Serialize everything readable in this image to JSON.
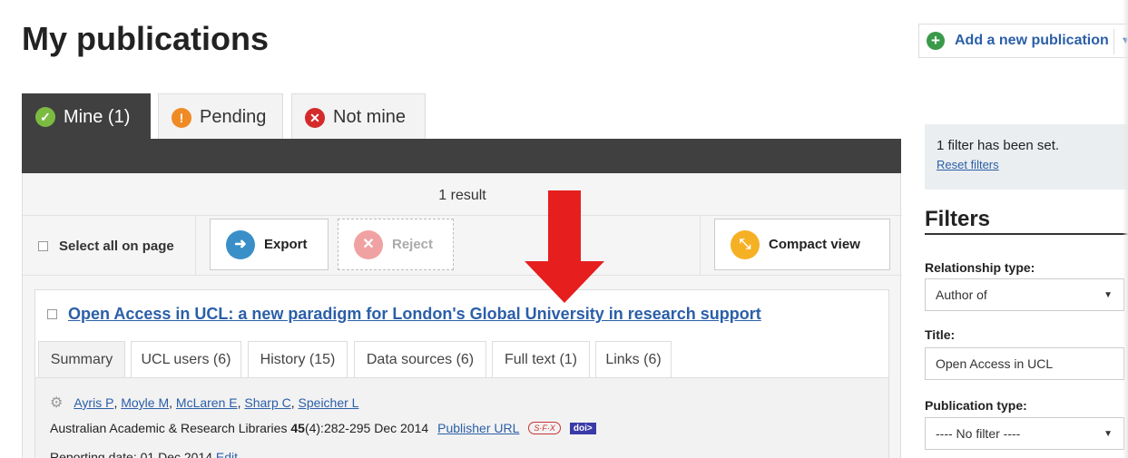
{
  "header": {
    "title": "My publications",
    "add_publication_label": "Add a new publication"
  },
  "tabs": [
    {
      "label": "Mine (1)",
      "icon": "check-circle-icon"
    },
    {
      "label": "Pending",
      "icon": "exclamation-circle-icon"
    },
    {
      "label": "Not mine",
      "icon": "x-circle-icon"
    }
  ],
  "results": {
    "count_text": "1 result",
    "select_all_label": "Select all on page",
    "export_label": "Export",
    "reject_label": "Reject",
    "compact_view_label": "Compact view"
  },
  "publication": {
    "title": "Open Access in UCL: a new paradigm for London's Global University in research support",
    "sub_tabs": [
      {
        "label": "Summary"
      },
      {
        "label": "UCL users (6)"
      },
      {
        "label": "History (15)"
      },
      {
        "label": "Data sources (6)"
      },
      {
        "label": "Full text (1)"
      },
      {
        "label": "Links (6)"
      }
    ],
    "authors": [
      "Ayris P",
      "Moyle M",
      "McLaren E",
      "Sharp C",
      "Speicher L"
    ],
    "journal": "Australian Academic & Research Libraries",
    "volume": "45",
    "issue_pages_date": "(4):282-295 Dec 2014",
    "publisher_url_label": "Publisher URL",
    "sfx_label": "S·F·X",
    "doi_label": "doi>",
    "reporting_date_text": "Reporting date: 01 Dec 2014",
    "edit_label": "Edit"
  },
  "filters": {
    "notice": "1 filter has been set.",
    "reset_label": "Reset filters",
    "heading": "Filters",
    "relationship_type_label": "Relationship type:",
    "relationship_type_value": "Author of",
    "title_label": "Title:",
    "title_value": "Open Access in UCL",
    "publication_type_label": "Publication type:",
    "publication_type_value": "---- No filter ----"
  },
  "colors": {
    "accent_link": "#2b5fa8",
    "tab_active": "#404040",
    "arrow": "#e61e1e"
  }
}
